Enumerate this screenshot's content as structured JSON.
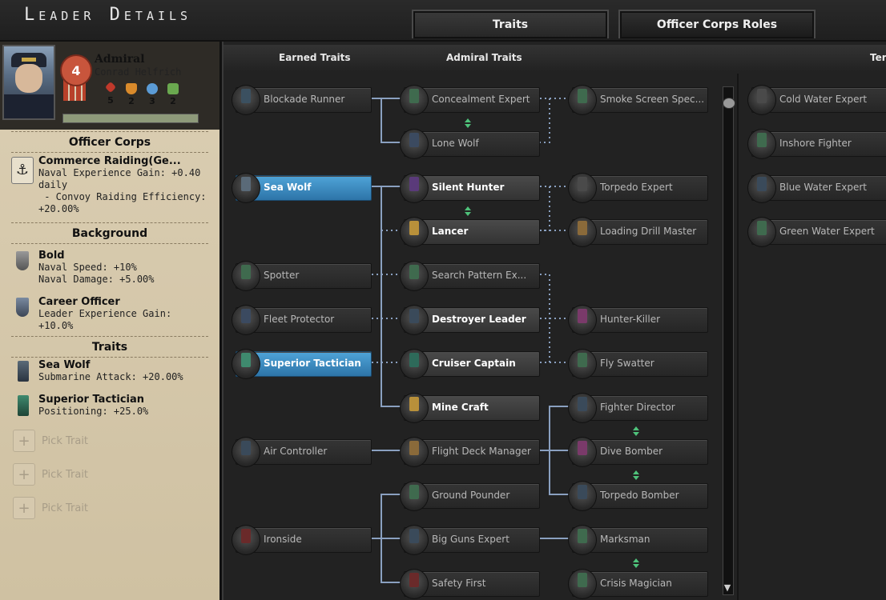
{
  "header": {
    "title": "Leader Details",
    "tabs": [
      {
        "label": "Traits",
        "active": true
      },
      {
        "label": "Officer Corps Roles",
        "active": false
      }
    ]
  },
  "leader": {
    "rank": "Admiral",
    "name": "Conrad Helfrich",
    "rank_level": "4",
    "skills": [
      {
        "icon": "attack-icon",
        "value": "5",
        "color": "#c0392b"
      },
      {
        "icon": "defense-icon",
        "value": "2",
        "color": "#d98a2b"
      },
      {
        "icon": "maneuvering-icon",
        "value": "3",
        "color": "#5b9bd5"
      },
      {
        "icon": "coordination-icon",
        "value": "2",
        "color": "#6aa84f"
      }
    ]
  },
  "left_panel": {
    "officer_corps": {
      "heading": "Officer Corps",
      "entries": [
        {
          "name": "Commerce Raiding(Ge...",
          "desc": "Naval Experience Gain: +0.40\ndaily\n - Convoy Raiding Efficiency:\n+20.00%"
        }
      ]
    },
    "background": {
      "heading": "Background",
      "entries": [
        {
          "name": "Bold",
          "desc": "Naval Speed: +10%\nNaval Damage: +5.00%"
        },
        {
          "name": "Career Officer",
          "desc": "Leader Experience Gain:\n+10.0%"
        }
      ]
    },
    "traits": {
      "heading": "Traits",
      "entries": [
        {
          "name": "Sea Wolf",
          "desc": "Submarine Attack: +20.00%"
        },
        {
          "name": "Superior Tactician",
          "desc": "Positioning: +25.0%"
        }
      ],
      "pick_label": "Pick Trait"
    }
  },
  "columns": {
    "earned": "Earned Traits",
    "admiral": "Admiral Traits",
    "terrain": "Ter"
  },
  "tree": {
    "earned": [
      "Blockade Runner",
      "Sea Wolf",
      "Spotter",
      "Fleet Protector",
      "Superior Tactician",
      "Air Controller",
      "Ironside"
    ],
    "admiral_mid": [
      "Concealment Expert",
      "Lone Wolf",
      "Silent Hunter",
      "Lancer",
      "Search Pattern Ex...",
      "Destroyer Leader",
      "Cruiser Captain",
      "Mine Craft",
      "Flight Deck Manager",
      "Ground Pounder",
      "Big Guns Expert",
      "Safety First"
    ],
    "admiral_right": [
      "Smoke Screen Spec...",
      "Torpedo Expert",
      "Loading Drill Master",
      "Hunter-Killer",
      "Fly Swatter",
      "Fighter Director",
      "Dive Bomber",
      "Torpedo Bomber",
      "Marksman",
      "Crisis Magician"
    ],
    "terrain": [
      "Cold Water Expert",
      "Inshore Fighter",
      "Blue Water Expert",
      "Green Water Expert"
    ]
  }
}
